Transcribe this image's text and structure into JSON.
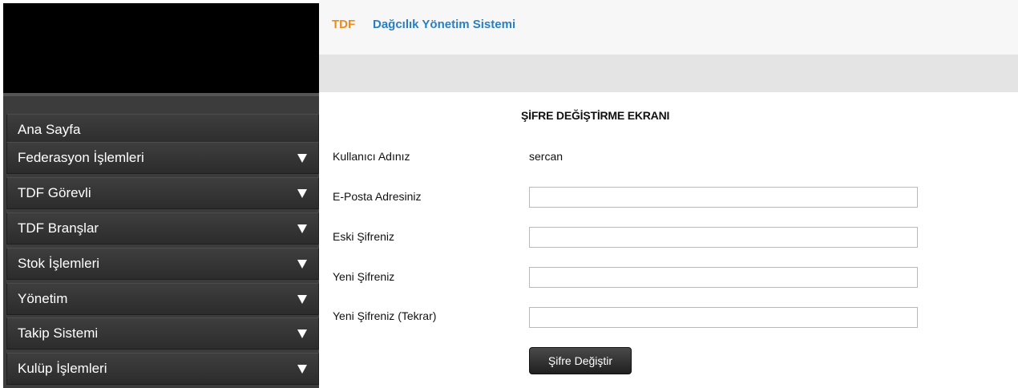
{
  "header": {
    "brand": "TDF",
    "title": "Dağcılık Yönetim Sistemi"
  },
  "sidebar": {
    "items": [
      {
        "label": "Ana Sayfa",
        "has_submenu": false
      },
      {
        "label": "Federasyon İşlemleri",
        "has_submenu": true
      },
      {
        "label": "TDF Görevli",
        "has_submenu": true
      },
      {
        "label": "TDF Branşlar",
        "has_submenu": true
      },
      {
        "label": "Stok İşlemleri",
        "has_submenu": true
      },
      {
        "label": "Yönetim",
        "has_submenu": true
      },
      {
        "label": "Takip Sistemi",
        "has_submenu": true
      },
      {
        "label": "Kulüp İşlemleri",
        "has_submenu": true
      }
    ]
  },
  "form": {
    "title": "ŞİFRE DEĞİŞTİRME EKRANI",
    "username_label": "Kullanıcı Adınız",
    "username_value": "sercan",
    "email_label": "E-Posta Adresiniz",
    "email_value": "",
    "old_password_label": "Eski Şifreniz",
    "old_password_value": "",
    "new_password_label": "Yeni Şifreniz",
    "new_password_value": "",
    "new_password_repeat_label": "Yeni Şifreniz (Tekrar)",
    "new_password_repeat_value": "",
    "submit_label": "Şifre Değiştir"
  },
  "colors": {
    "brand": "#ef8a1a",
    "title": "#2a7fc1",
    "sidebar_bg": "#3c3c3c",
    "header_bg": "#f7f7f7",
    "subbar_bg": "#e4e4e4"
  }
}
